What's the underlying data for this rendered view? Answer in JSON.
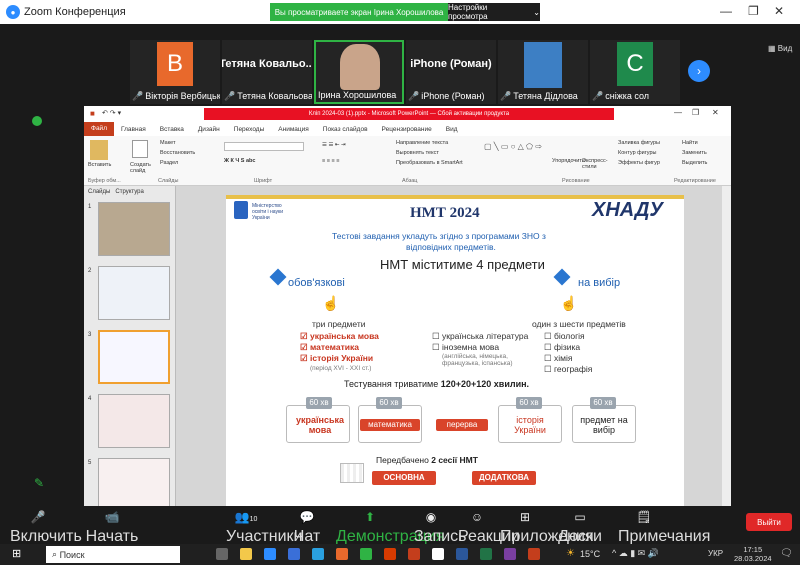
{
  "zoom": {
    "window_title": "Zoom Конференция",
    "share_banner": "Вы просматриваете экран Ірина Хорошилова",
    "view_settings": "Настройки просмотра",
    "view_button": "Вид",
    "min": "—",
    "max": "❐",
    "close": "✕"
  },
  "participants": [
    {
      "initial": "B",
      "name": "Вікторія Вербицька",
      "color": "#e8692c"
    },
    {
      "initial": "",
      "big": "Тетяна Ковальо...",
      "name": "Тетяна Ковальова"
    },
    {
      "initial": "",
      "name": "Ірина Хорошилова"
    },
    {
      "initial": "",
      "big": "iPhone (Роман)",
      "name": "iPhone (Роман)"
    },
    {
      "initial": "",
      "name": "Тетяна Дідлова"
    },
    {
      "initial": "C",
      "name": "сніжка сол",
      "color": "#1f8a4c"
    }
  ],
  "ppt": {
    "title": "Кліп 2024-03 (1).pptx - Microsoft PowerPoint",
    "red_bar": "Сбой активации продукта",
    "tabs": [
      "Файл",
      "Главная",
      "Вставка",
      "Дизайн",
      "Переходы",
      "Анимация",
      "Показ слайдов",
      "Рецензирование",
      "Вид"
    ],
    "ribbon_groups": [
      "Буфер обм...",
      "Слайды",
      "Шрифт",
      "Абзац",
      "Рисование",
      "Редактирование"
    ],
    "ribbon_buttons": {
      "paste": "Вставить",
      "create": "Создать слайд",
      "layout": "Макет",
      "reset": "Восстановить",
      "section": "Раздел",
      "text_dir": "Направление текста",
      "align_text": "Выровнять текст",
      "smartart": "Преобразовать в SmartArt",
      "arrange": "Упорядочить",
      "quick_styles": "Экспресс-стили",
      "fill": "Заливка фигуры",
      "outline": "Контур фигуры",
      "effects": "Эффекты фигур",
      "find": "Найти",
      "replace": "Заменить",
      "select": "Выделить"
    },
    "pane_tabs": [
      "Слайды",
      "Структура"
    ],
    "thumb_numbers": [
      "1",
      "2",
      "3",
      "4",
      "5"
    ]
  },
  "slide": {
    "title": "НМТ 2024",
    "logo": "ХНАДУ",
    "ministry": "Міністерство освіти і науки України",
    "subtitle1": "Тестові завдання укладуть згідно з програмами ЗНО з",
    "subtitle2": "відповідних предметів.",
    "heading": "НМТ міститиме 4 предмети",
    "mandatory": "обов'язкові",
    "elective": "на вибір",
    "three": "три предмети",
    "one_of_six": "один з шести предметів",
    "required_subjects": [
      "українська мова",
      "математика",
      "історія України"
    ],
    "period": "(період XVI - XXI ст.)",
    "mid_subjects": [
      "українська література",
      "іноземна мова"
    ],
    "languages": "(англійська, німецька, французька, іспанська)",
    "right_subjects": [
      "біологія",
      "фізика",
      "хімія",
      "географія"
    ],
    "duration_label": "Тестування триватиме",
    "duration_value": "120+20+120 хвилин.",
    "minutes": [
      "60 хв",
      "60 хв",
      "60 хв",
      "60 хв"
    ],
    "flow": [
      "українська мова",
      "математика",
      "перерва",
      "історія України",
      "предмет на вибір"
    ],
    "sessions_prefix": "Передбачено",
    "sessions_bold": "2 сесії НМТ",
    "session_main": "ОСНОВНА",
    "session_extra": "ДОДАТКОВА"
  },
  "toolbar": {
    "mute": "Включить звук",
    "video": "Начать видео",
    "participants": "Участники",
    "participants_count": "10",
    "chat": "Чат",
    "share": "Демонстрация экрана",
    "record": "Запись",
    "reactions": "Реакции",
    "apps": "Приложения",
    "whiteboard": "Доски сообщений",
    "notes": "Примечания",
    "leave": "Выйти"
  },
  "taskbar": {
    "search": "Поиск",
    "weather": "15°C",
    "lang": "УКР",
    "time": "17:15",
    "date": "28.03.2024"
  }
}
